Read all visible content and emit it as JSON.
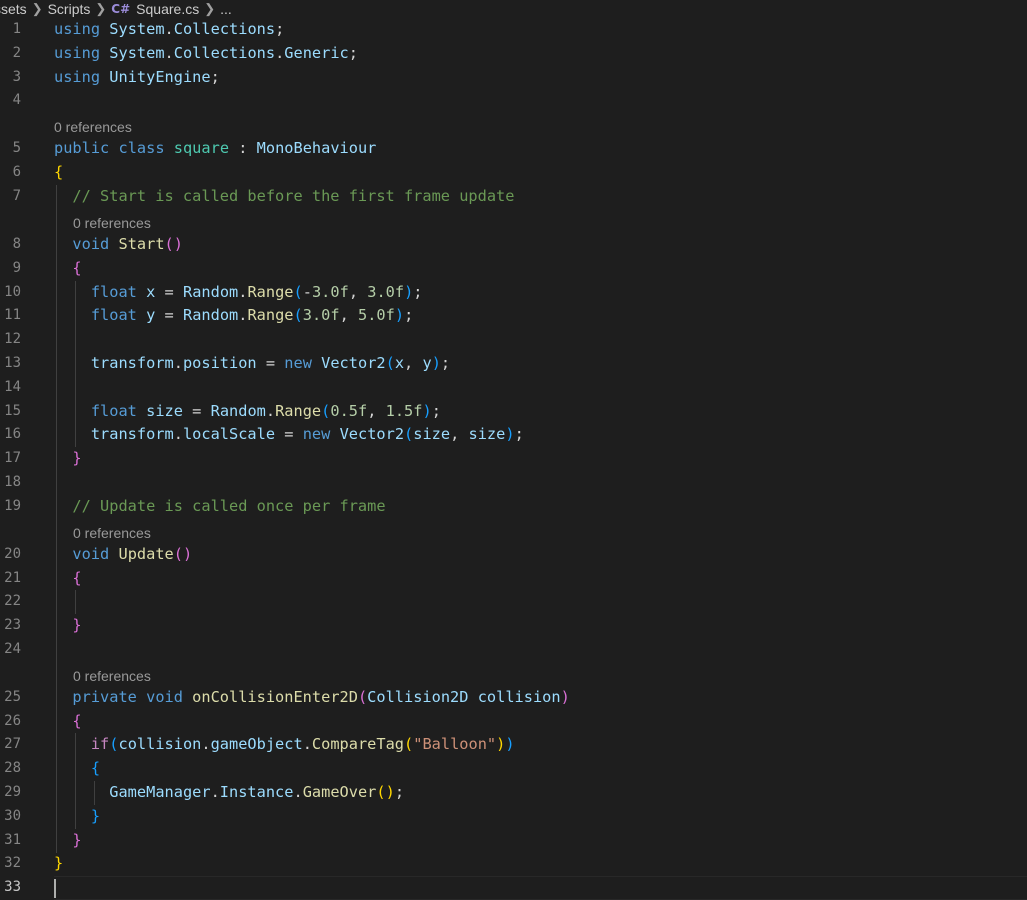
{
  "breadcrumb": {
    "items": [
      "ssets",
      "Scripts",
      "Square.cs",
      "..."
    ],
    "file_icon": "csharp-file-icon"
  },
  "editor": {
    "active_line": 33,
    "lines": [
      {
        "n": 1,
        "tokens": [
          [
            "using",
            "kw"
          ],
          [
            " ",
            "pl"
          ],
          [
            "System",
            "vr"
          ],
          [
            ".",
            "pl"
          ],
          [
            "Collections",
            "vr"
          ],
          [
            ";",
            "pl"
          ]
        ]
      },
      {
        "n": 2,
        "tokens": [
          [
            "using",
            "kw"
          ],
          [
            " ",
            "pl"
          ],
          [
            "System",
            "vr"
          ],
          [
            ".",
            "pl"
          ],
          [
            "Collections",
            "vr"
          ],
          [
            ".",
            "pl"
          ],
          [
            "Generic",
            "vr"
          ],
          [
            ";",
            "pl"
          ]
        ]
      },
      {
        "n": 3,
        "tokens": [
          [
            "using",
            "kw"
          ],
          [
            " ",
            "pl"
          ],
          [
            "UnityEngine",
            "vr"
          ],
          [
            ";",
            "pl"
          ]
        ]
      },
      {
        "n": 4,
        "tokens": []
      },
      {
        "lens": "0 references",
        "indent": 0
      },
      {
        "n": 5,
        "tokens": [
          [
            "public",
            "kw"
          ],
          [
            " ",
            "pl"
          ],
          [
            "class",
            "kw"
          ],
          [
            " ",
            "pl"
          ],
          [
            "square",
            "ty"
          ],
          [
            " : ",
            "pl"
          ],
          [
            "MonoBehaviour",
            "vr"
          ]
        ]
      },
      {
        "n": 6,
        "tokens": [
          [
            "{",
            "b1"
          ]
        ]
      },
      {
        "n": 7,
        "tokens": [
          [
            "  ",
            "pl"
          ],
          [
            "// Start is called before the first frame update",
            "cm"
          ]
        ]
      },
      {
        "lens": "0 references",
        "indent": 2
      },
      {
        "n": 8,
        "tokens": [
          [
            "  ",
            "pl"
          ],
          [
            "void",
            "kw"
          ],
          [
            " ",
            "pl"
          ],
          [
            "Start",
            "fn"
          ],
          [
            "()",
            "b2"
          ]
        ]
      },
      {
        "n": 9,
        "tokens": [
          [
            "  ",
            "pl"
          ],
          [
            "{",
            "b2"
          ]
        ]
      },
      {
        "n": 10,
        "tokens": [
          [
            "    ",
            "pl"
          ],
          [
            "float",
            "kw"
          ],
          [
            " ",
            "pl"
          ],
          [
            "x",
            "vr"
          ],
          [
            " = ",
            "pl"
          ],
          [
            "Random",
            "vr"
          ],
          [
            ".",
            "pl"
          ],
          [
            "Range",
            "fn"
          ],
          [
            "(",
            "b3"
          ],
          [
            "-",
            "pl"
          ],
          [
            "3.0f",
            "nm"
          ],
          [
            ", ",
            "pl"
          ],
          [
            "3.0f",
            "nm"
          ],
          [
            ")",
            "b3"
          ],
          [
            ";",
            "pl"
          ]
        ]
      },
      {
        "n": 11,
        "tokens": [
          [
            "    ",
            "pl"
          ],
          [
            "float",
            "kw"
          ],
          [
            " ",
            "pl"
          ],
          [
            "y",
            "vr"
          ],
          [
            " = ",
            "pl"
          ],
          [
            "Random",
            "vr"
          ],
          [
            ".",
            "pl"
          ],
          [
            "Range",
            "fn"
          ],
          [
            "(",
            "b3"
          ],
          [
            "3.0f",
            "nm"
          ],
          [
            ", ",
            "pl"
          ],
          [
            "5.0f",
            "nm"
          ],
          [
            ")",
            "b3"
          ],
          [
            ";",
            "pl"
          ]
        ]
      },
      {
        "n": 12,
        "tokens": []
      },
      {
        "n": 13,
        "tokens": [
          [
            "    ",
            "pl"
          ],
          [
            "transform",
            "vr"
          ],
          [
            ".",
            "pl"
          ],
          [
            "position",
            "vr"
          ],
          [
            " = ",
            "pl"
          ],
          [
            "new",
            "kw"
          ],
          [
            " ",
            "pl"
          ],
          [
            "Vector2",
            "vr"
          ],
          [
            "(",
            "b3"
          ],
          [
            "x",
            "vr"
          ],
          [
            ", ",
            "pl"
          ],
          [
            "y",
            "vr"
          ],
          [
            ")",
            "b3"
          ],
          [
            ";",
            "pl"
          ]
        ]
      },
      {
        "n": 14,
        "tokens": []
      },
      {
        "n": 15,
        "tokens": [
          [
            "    ",
            "pl"
          ],
          [
            "float",
            "kw"
          ],
          [
            " ",
            "pl"
          ],
          [
            "size",
            "vr"
          ],
          [
            " = ",
            "pl"
          ],
          [
            "Random",
            "vr"
          ],
          [
            ".",
            "pl"
          ],
          [
            "Range",
            "fn"
          ],
          [
            "(",
            "b3"
          ],
          [
            "0.5f",
            "nm"
          ],
          [
            ", ",
            "pl"
          ],
          [
            "1.5f",
            "nm"
          ],
          [
            ")",
            "b3"
          ],
          [
            ";",
            "pl"
          ]
        ]
      },
      {
        "n": 16,
        "tokens": [
          [
            "    ",
            "pl"
          ],
          [
            "transform",
            "vr"
          ],
          [
            ".",
            "pl"
          ],
          [
            "localScale",
            "vr"
          ],
          [
            " = ",
            "pl"
          ],
          [
            "new",
            "kw"
          ],
          [
            " ",
            "pl"
          ],
          [
            "Vector2",
            "vr"
          ],
          [
            "(",
            "b3"
          ],
          [
            "size",
            "vr"
          ],
          [
            ", ",
            "pl"
          ],
          [
            "size",
            "vr"
          ],
          [
            ")",
            "b3"
          ],
          [
            ";",
            "pl"
          ]
        ]
      },
      {
        "n": 17,
        "tokens": [
          [
            "  ",
            "pl"
          ],
          [
            "}",
            "b2"
          ]
        ]
      },
      {
        "n": 18,
        "tokens": []
      },
      {
        "n": 19,
        "tokens": [
          [
            "  ",
            "pl"
          ],
          [
            "// Update is called once per frame",
            "cm"
          ]
        ]
      },
      {
        "lens": "0 references",
        "indent": 2
      },
      {
        "n": 20,
        "tokens": [
          [
            "  ",
            "pl"
          ],
          [
            "void",
            "kw"
          ],
          [
            " ",
            "pl"
          ],
          [
            "Update",
            "fn"
          ],
          [
            "()",
            "b2"
          ]
        ]
      },
      {
        "n": 21,
        "tokens": [
          [
            "  ",
            "pl"
          ],
          [
            "{",
            "b2"
          ]
        ]
      },
      {
        "n": 22,
        "tokens": []
      },
      {
        "n": 23,
        "tokens": [
          [
            "  ",
            "pl"
          ],
          [
            "}",
            "b2"
          ]
        ]
      },
      {
        "n": 24,
        "tokens": []
      },
      {
        "lens": "0 references",
        "indent": 2
      },
      {
        "n": 25,
        "tokens": [
          [
            "  ",
            "pl"
          ],
          [
            "private",
            "kw"
          ],
          [
            " ",
            "pl"
          ],
          [
            "void",
            "kw"
          ],
          [
            " ",
            "pl"
          ],
          [
            "onCollisionEnter2D",
            "fn"
          ],
          [
            "(",
            "b2"
          ],
          [
            "Collision2D",
            "vr"
          ],
          [
            " ",
            "pl"
          ],
          [
            "collision",
            "vr"
          ],
          [
            ")",
            "b2"
          ]
        ]
      },
      {
        "n": 26,
        "tokens": [
          [
            "  ",
            "pl"
          ],
          [
            "{",
            "b2"
          ]
        ]
      },
      {
        "n": 27,
        "tokens": [
          [
            "    ",
            "pl"
          ],
          [
            "if",
            "ctrl"
          ],
          [
            "(",
            "b3"
          ],
          [
            "collision",
            "vr"
          ],
          [
            ".",
            "pl"
          ],
          [
            "gameObject",
            "vr"
          ],
          [
            ".",
            "pl"
          ],
          [
            "CompareTag",
            "fn"
          ],
          [
            "(",
            "b1"
          ],
          [
            "\"Balloon\"",
            "st"
          ],
          [
            ")",
            "b1"
          ],
          [
            ")",
            "b3"
          ]
        ]
      },
      {
        "n": 28,
        "tokens": [
          [
            "    ",
            "pl"
          ],
          [
            "{",
            "b3"
          ]
        ]
      },
      {
        "n": 29,
        "tokens": [
          [
            "      ",
            "pl"
          ],
          [
            "GameManager",
            "vr"
          ],
          [
            ".",
            "pl"
          ],
          [
            "Instance",
            "vr"
          ],
          [
            ".",
            "pl"
          ],
          [
            "GameOver",
            "fn"
          ],
          [
            "()",
            "b1"
          ],
          [
            ";",
            "pl"
          ]
        ]
      },
      {
        "n": 30,
        "tokens": [
          [
            "    ",
            "pl"
          ],
          [
            "}",
            "b3"
          ]
        ]
      },
      {
        "n": 31,
        "tokens": [
          [
            "  ",
            "pl"
          ],
          [
            "}",
            "b2"
          ]
        ]
      },
      {
        "n": 32,
        "tokens": [
          [
            "}",
            "b1"
          ]
        ]
      },
      {
        "n": 33,
        "tokens": []
      }
    ]
  }
}
